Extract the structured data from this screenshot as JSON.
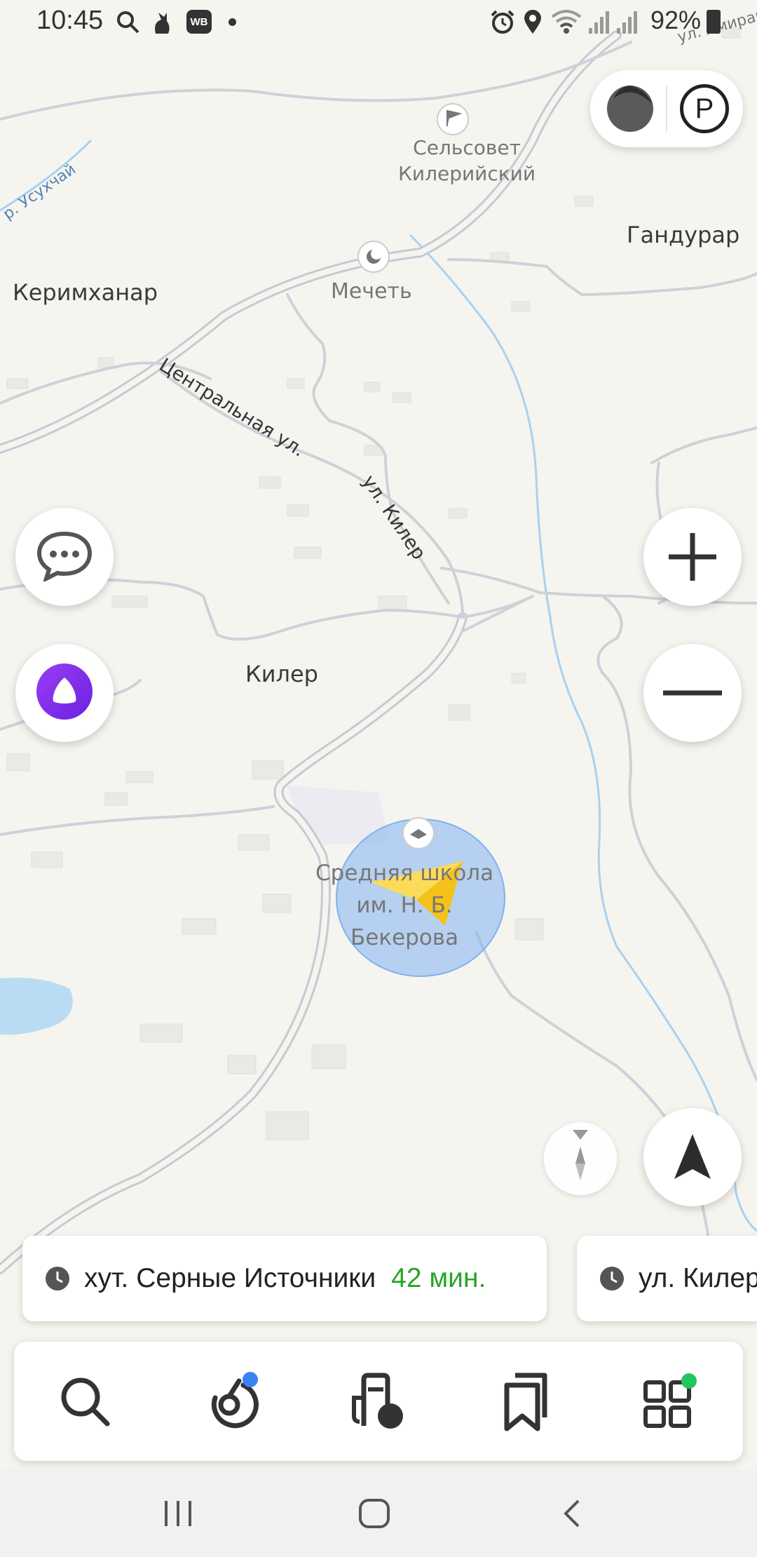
{
  "status_bar": {
    "time": "10:45",
    "battery": "92%",
    "left_icons": [
      "search-icon",
      "cat-icon",
      "wb-icon",
      "dot-icon"
    ],
    "right_icons": [
      "alarm-icon",
      "location-icon",
      "wifi-icon",
      "signal-icon",
      "signal-icon",
      "battery-icon"
    ]
  },
  "map": {
    "labels": {
      "selsovet": "Сельсовет\nКилерийский",
      "gandurar": "Гандурар",
      "kerimkhanar": "Керимханар",
      "mosque": "Мечеть",
      "kiler": "Килер",
      "school": "Средняя школа\nим. Н. Б.\nБекерова",
      "central_street": "Центральная ул.",
      "kiler_street": "ул. Килер",
      "usukhchay": "р. Усухчай",
      "amirar_street": "ул. Амирар"
    },
    "colors": {
      "water": "#b9dcf4",
      "road": "#c9ced8",
      "accuracy_circle": "#7fb2f0",
      "arrow": "#f5c21b"
    }
  },
  "controls": {
    "layers_icon": "layers-icon",
    "parking_label": "P",
    "messages_icon": "chat-icon",
    "alice_icon": "alice-icon",
    "zoom_in_label": "+",
    "zoom_out_label": "−",
    "compass_icon": "compass-icon",
    "my_location_icon": "navigation-arrow-icon"
  },
  "routes": [
    {
      "destination": "хут. Серные Источники",
      "time": "42 мин."
    },
    {
      "destination": "ул. Килер",
      "time": ""
    }
  ],
  "bottom_tabs": [
    {
      "name": "search",
      "icon": "search-icon"
    },
    {
      "name": "navigator",
      "icon": "navigator-icon",
      "badge_color": "#3b82f6"
    },
    {
      "name": "gas-stations",
      "icon": "gas-station-icon"
    },
    {
      "name": "bookmarks",
      "icon": "bookmark-icon"
    },
    {
      "name": "services",
      "icon": "services-grid-icon",
      "badge_color": "#22c55e"
    }
  ],
  "system_nav": [
    "recents-icon",
    "home-icon",
    "back-icon"
  ]
}
